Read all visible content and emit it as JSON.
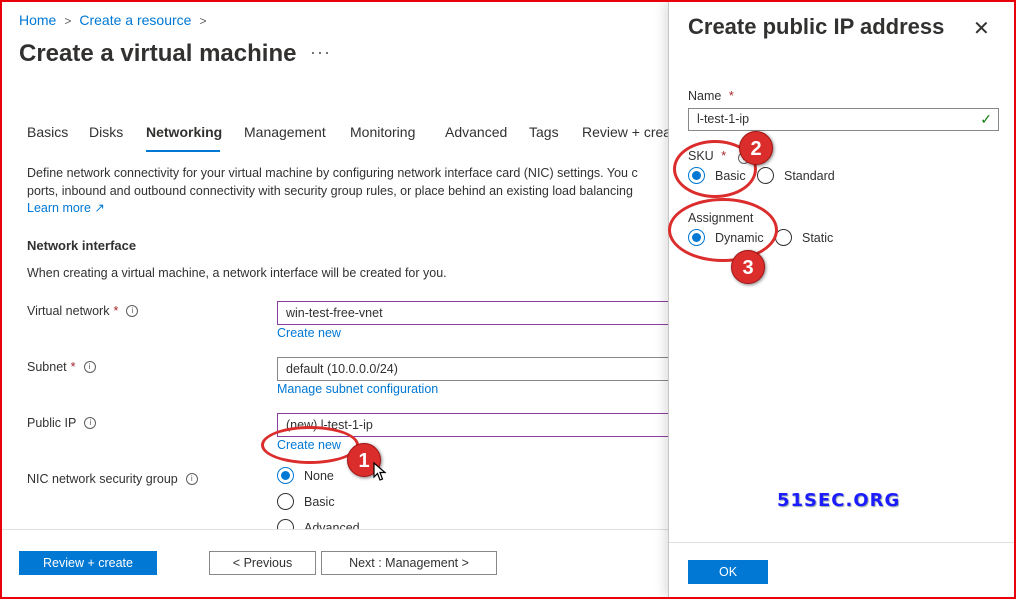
{
  "breadcrumb": {
    "home": "Home",
    "create": "Create a resource"
  },
  "page_title": "Create a virtual machine",
  "more_label": "···",
  "tabs": [
    "Basics",
    "Disks",
    "Networking",
    "Management",
    "Monitoring",
    "Advanced",
    "Tags",
    "Review + crea"
  ],
  "description": {
    "line1": "Define network connectivity for your virtual machine by configuring network interface card (NIC) settings. You c",
    "line2": "ports, inbound and outbound connectivity with security group rules, or place behind an existing load balancing",
    "learn_more": "Learn more"
  },
  "network_interface": {
    "heading": "Network interface",
    "text": "When creating a virtual machine, a network interface will be created for you."
  },
  "fields": {
    "vnet": {
      "label": "Virtual network",
      "required": "*",
      "value": "win-test-free-vnet",
      "link": "Create new"
    },
    "subnet": {
      "label": "Subnet",
      "required": "*",
      "value": "default (10.0.0.0/24)",
      "link": "Manage subnet configuration"
    },
    "public_ip": {
      "label": "Public IP",
      "value": "(new) l-test-1-ip",
      "link": "Create new"
    },
    "nsg": {
      "label": "NIC network security group",
      "options": [
        "None",
        "Basic",
        "Advanced"
      ],
      "selected": "None"
    }
  },
  "footer": {
    "review": "Review + create",
    "previous": "< Previous",
    "next": "Next : Management >"
  },
  "panel": {
    "title": "Create public IP address",
    "name_label": "Name",
    "required": "*",
    "name_value": "l-test-1-ip",
    "sku_label": "SKU",
    "sku_options": [
      "Basic",
      "Standard"
    ],
    "sku_selected": "Basic",
    "assignment_label": "Assignment",
    "assignment_options": [
      "Dynamic",
      "Static"
    ],
    "assignment_selected": "Dynamic",
    "ok": "OK",
    "watermark": "51SEC.ORG"
  },
  "annotations": [
    "1",
    "2",
    "3"
  ],
  "colors": {
    "accent": "#0078d4",
    "annotation": "#dc2d2d",
    "frame": "#e8000b"
  }
}
